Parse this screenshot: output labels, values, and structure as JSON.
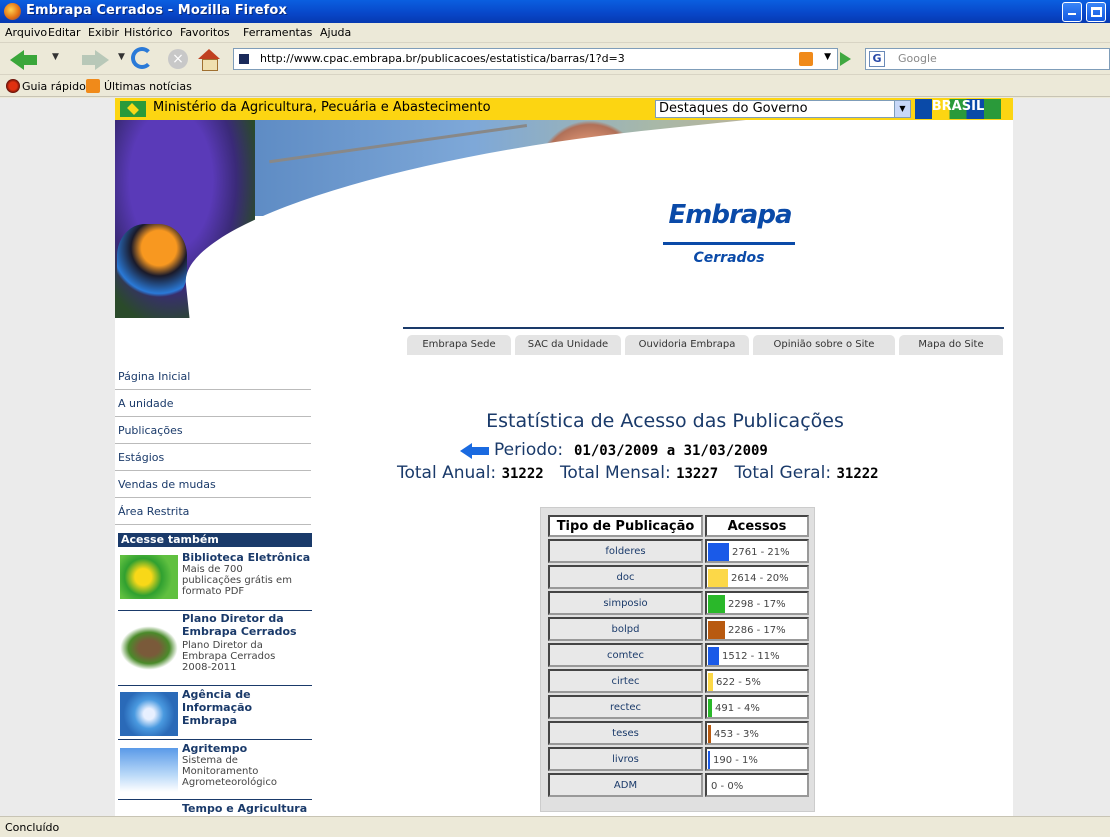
{
  "window": {
    "title": "Embrapa Cerrados - Mozilla Firefox"
  },
  "menu": [
    "Arquivo",
    "Editar",
    "Exibir",
    "Histórico",
    "Favoritos",
    "Ferramentas",
    "Ajuda"
  ],
  "address": {
    "url": "http://www.cpac.embrapa.br/publicacoes/estatistica/barras/1?d=3"
  },
  "search": {
    "placeholder": "Google"
  },
  "bookmarks": [
    "Guia rápido",
    "Últimas notícias"
  ],
  "gov": {
    "ministry": "Ministério da Agricultura, Pecuária e Abastecimento",
    "dropdown_selected": "Destaques do Governo",
    "brasil_logo": "BRASIL"
  },
  "brand": {
    "logo": "Embrapa",
    "unit": "Cerrados"
  },
  "topnav": [
    "Embrapa Sede",
    "SAC da Unidade",
    "Ouvidoria Embrapa",
    "Opinião sobre o Site",
    "Mapa do Site"
  ],
  "leftnav": [
    "Página Inicial",
    "A unidade",
    "Publicações",
    "Estágios",
    "Vendas de mudas",
    "Área Restrita"
  ],
  "acesse": {
    "heading": "Acesse também",
    "items": [
      {
        "title": "Biblioteca Eletrônica",
        "desc": [
          "Mais de 700",
          "publicações grátis em",
          "formato PDF"
        ]
      },
      {
        "title": "Plano Diretor da Embrapa Cerrados",
        "desc": [
          "Plano Diretor da",
          "Embrapa Cerrados",
          "2008-2011"
        ]
      },
      {
        "title": "Agência de Informação Embrapa",
        "desc": []
      },
      {
        "title": "Agritempo",
        "desc": [
          "Sistema de",
          "Monitoramento",
          "Agrometeorológico"
        ]
      },
      {
        "title": "Tempo e Agricultura",
        "desc": []
      }
    ]
  },
  "stats": {
    "title": "Estatística de Acesso das Publicações",
    "periodo_label": "Periodo:",
    "periodo_value": "01/03/2009 a 31/03/2009",
    "total_anual_label": "Total Anual:",
    "total_anual": "31222",
    "total_mensal_label": "Total Mensal:",
    "total_mensal": "13227",
    "total_geral_label": "Total Geral:",
    "total_geral": "31222",
    "col_tipo": "Tipo de Publicação",
    "col_acessos": "Acessos",
    "rows": [
      {
        "tipo": "folderes",
        "label": "2761 - 21%",
        "pct": 0.21,
        "color": "#1a5ae8"
      },
      {
        "tipo": "doc",
        "label": "2614 - 20%",
        "pct": 0.2,
        "color": "#fcd848"
      },
      {
        "tipo": "simposio",
        "label": "2298 - 17%",
        "pct": 0.17,
        "color": "#2ab82a"
      },
      {
        "tipo": "bolpd",
        "label": "2286 - 17%",
        "pct": 0.17,
        "color": "#b85a10"
      },
      {
        "tipo": "comtec",
        "label": "1512 - 11%",
        "pct": 0.11,
        "color": "#1a5ae8"
      },
      {
        "tipo": "cirtec",
        "label": "622 - 5%",
        "pct": 0.05,
        "color": "#fcd848"
      },
      {
        "tipo": "rectec",
        "label": "491 - 4%",
        "pct": 0.04,
        "color": "#2ab82a"
      },
      {
        "tipo": "teses",
        "label": "453 - 3%",
        "pct": 0.03,
        "color": "#b85a10"
      },
      {
        "tipo": "livros",
        "label": "190 - 1%",
        "pct": 0.01,
        "color": "#1a5ae8"
      },
      {
        "tipo": "ADM",
        "label": "0 - 0%",
        "pct": 0.0,
        "color": "#fcd848"
      }
    ]
  },
  "status": {
    "text": "Concluído"
  }
}
